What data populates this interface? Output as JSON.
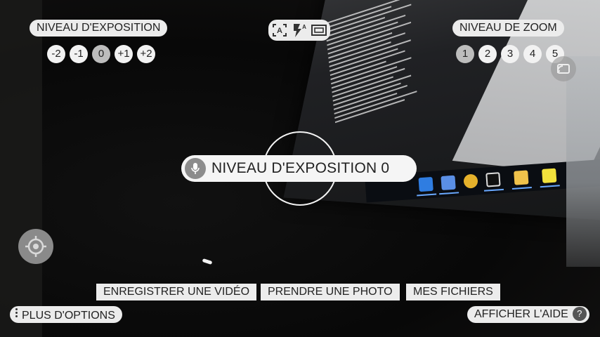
{
  "exposure": {
    "title": "NIVEAU D'EXPOSITION",
    "levels": [
      "-2",
      "-1",
      "0",
      "+1",
      "+2"
    ],
    "selected": "0"
  },
  "zoom": {
    "title": "NIVEAU DE ZOOM",
    "levels": [
      "1",
      "2",
      "3",
      "4",
      "5"
    ],
    "selected": "1"
  },
  "camera_modes": {
    "icons": [
      "auto-mode-icon",
      "flash-auto-icon",
      "aspect-ratio-icon"
    ],
    "flash_sup": "A",
    "auto_letter": "A"
  },
  "toast": {
    "text": "NIVEAU D'EXPOSITION 0",
    "icon": "microphone-icon"
  },
  "actions": {
    "record_video": "ENREGISTRER UNE VIDÉO",
    "take_photo": "PRENDRE UNE PHOTO",
    "my_files": "MES FICHIERS"
  },
  "more_options": "PLUS D'OPTIONS",
  "help": {
    "label": "AFFICHER L'AIDE",
    "symbol": "?"
  },
  "colors": {
    "pill_bg": "#ececec",
    "selected_level": "#bdbdbd",
    "text": "#222222"
  }
}
